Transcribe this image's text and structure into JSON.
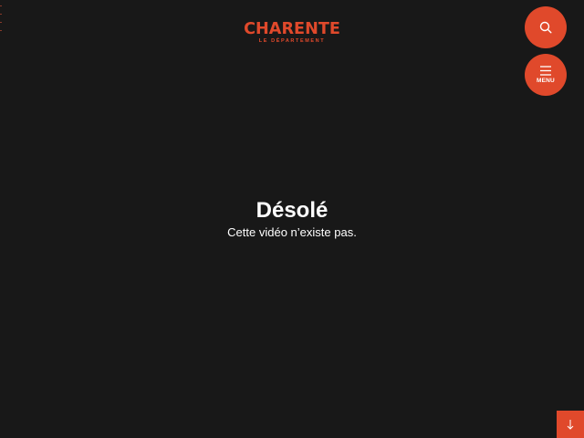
{
  "header": {
    "logo_title": "CHARENTE",
    "logo_subtitle": "LE DÉPARTEMENT"
  },
  "buttons": {
    "search_icon": "search-icon",
    "menu_icon": "hamburger-icon",
    "menu_label": "MENU",
    "scroll_icon": "arrow-down-icon"
  },
  "message": {
    "title": "Désolé",
    "text": "Cette vidéo n’existe pas."
  },
  "colors": {
    "background": "#181818",
    "accent": "#e0492b",
    "text": "#ffffff"
  }
}
